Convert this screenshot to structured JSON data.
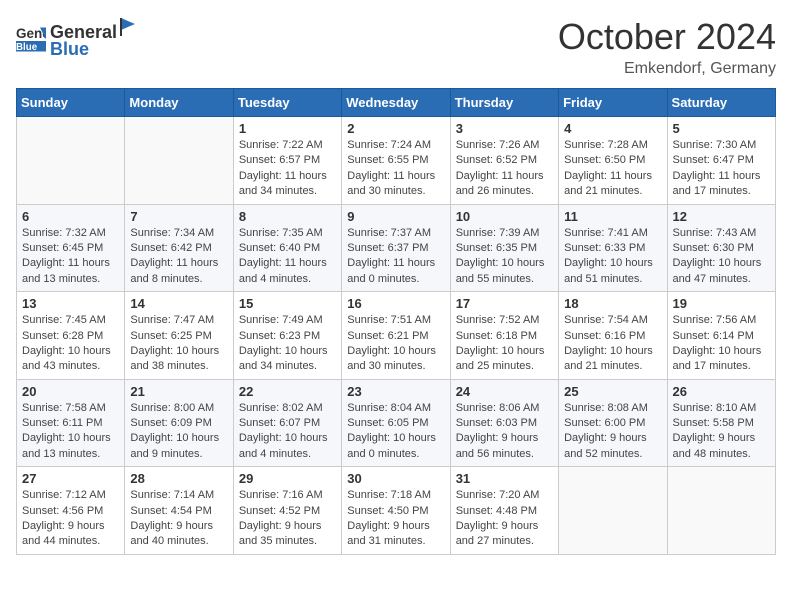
{
  "header": {
    "logo_general": "General",
    "logo_blue": "Blue",
    "month": "October 2024",
    "location": "Emkendorf, Germany"
  },
  "weekdays": [
    "Sunday",
    "Monday",
    "Tuesday",
    "Wednesday",
    "Thursday",
    "Friday",
    "Saturday"
  ],
  "weeks": [
    [
      {
        "day": "",
        "info": ""
      },
      {
        "day": "",
        "info": ""
      },
      {
        "day": "1",
        "info": "Sunrise: 7:22 AM\nSunset: 6:57 PM\nDaylight: 11 hours and 34 minutes."
      },
      {
        "day": "2",
        "info": "Sunrise: 7:24 AM\nSunset: 6:55 PM\nDaylight: 11 hours and 30 minutes."
      },
      {
        "day": "3",
        "info": "Sunrise: 7:26 AM\nSunset: 6:52 PM\nDaylight: 11 hours and 26 minutes."
      },
      {
        "day": "4",
        "info": "Sunrise: 7:28 AM\nSunset: 6:50 PM\nDaylight: 11 hours and 21 minutes."
      },
      {
        "day": "5",
        "info": "Sunrise: 7:30 AM\nSunset: 6:47 PM\nDaylight: 11 hours and 17 minutes."
      }
    ],
    [
      {
        "day": "6",
        "info": "Sunrise: 7:32 AM\nSunset: 6:45 PM\nDaylight: 11 hours and 13 minutes."
      },
      {
        "day": "7",
        "info": "Sunrise: 7:34 AM\nSunset: 6:42 PM\nDaylight: 11 hours and 8 minutes."
      },
      {
        "day": "8",
        "info": "Sunrise: 7:35 AM\nSunset: 6:40 PM\nDaylight: 11 hours and 4 minutes."
      },
      {
        "day": "9",
        "info": "Sunrise: 7:37 AM\nSunset: 6:37 PM\nDaylight: 11 hours and 0 minutes."
      },
      {
        "day": "10",
        "info": "Sunrise: 7:39 AM\nSunset: 6:35 PM\nDaylight: 10 hours and 55 minutes."
      },
      {
        "day": "11",
        "info": "Sunrise: 7:41 AM\nSunset: 6:33 PM\nDaylight: 10 hours and 51 minutes."
      },
      {
        "day": "12",
        "info": "Sunrise: 7:43 AM\nSunset: 6:30 PM\nDaylight: 10 hours and 47 minutes."
      }
    ],
    [
      {
        "day": "13",
        "info": "Sunrise: 7:45 AM\nSunset: 6:28 PM\nDaylight: 10 hours and 43 minutes."
      },
      {
        "day": "14",
        "info": "Sunrise: 7:47 AM\nSunset: 6:25 PM\nDaylight: 10 hours and 38 minutes."
      },
      {
        "day": "15",
        "info": "Sunrise: 7:49 AM\nSunset: 6:23 PM\nDaylight: 10 hours and 34 minutes."
      },
      {
        "day": "16",
        "info": "Sunrise: 7:51 AM\nSunset: 6:21 PM\nDaylight: 10 hours and 30 minutes."
      },
      {
        "day": "17",
        "info": "Sunrise: 7:52 AM\nSunset: 6:18 PM\nDaylight: 10 hours and 25 minutes."
      },
      {
        "day": "18",
        "info": "Sunrise: 7:54 AM\nSunset: 6:16 PM\nDaylight: 10 hours and 21 minutes."
      },
      {
        "day": "19",
        "info": "Sunrise: 7:56 AM\nSunset: 6:14 PM\nDaylight: 10 hours and 17 minutes."
      }
    ],
    [
      {
        "day": "20",
        "info": "Sunrise: 7:58 AM\nSunset: 6:11 PM\nDaylight: 10 hours and 13 minutes."
      },
      {
        "day": "21",
        "info": "Sunrise: 8:00 AM\nSunset: 6:09 PM\nDaylight: 10 hours and 9 minutes."
      },
      {
        "day": "22",
        "info": "Sunrise: 8:02 AM\nSunset: 6:07 PM\nDaylight: 10 hours and 4 minutes."
      },
      {
        "day": "23",
        "info": "Sunrise: 8:04 AM\nSunset: 6:05 PM\nDaylight: 10 hours and 0 minutes."
      },
      {
        "day": "24",
        "info": "Sunrise: 8:06 AM\nSunset: 6:03 PM\nDaylight: 9 hours and 56 minutes."
      },
      {
        "day": "25",
        "info": "Sunrise: 8:08 AM\nSunset: 6:00 PM\nDaylight: 9 hours and 52 minutes."
      },
      {
        "day": "26",
        "info": "Sunrise: 8:10 AM\nSunset: 5:58 PM\nDaylight: 9 hours and 48 minutes."
      }
    ],
    [
      {
        "day": "27",
        "info": "Sunrise: 7:12 AM\nSunset: 4:56 PM\nDaylight: 9 hours and 44 minutes."
      },
      {
        "day": "28",
        "info": "Sunrise: 7:14 AM\nSunset: 4:54 PM\nDaylight: 9 hours and 40 minutes."
      },
      {
        "day": "29",
        "info": "Sunrise: 7:16 AM\nSunset: 4:52 PM\nDaylight: 9 hours and 35 minutes."
      },
      {
        "day": "30",
        "info": "Sunrise: 7:18 AM\nSunset: 4:50 PM\nDaylight: 9 hours and 31 minutes."
      },
      {
        "day": "31",
        "info": "Sunrise: 7:20 AM\nSunset: 4:48 PM\nDaylight: 9 hours and 27 minutes."
      },
      {
        "day": "",
        "info": ""
      },
      {
        "day": "",
        "info": ""
      }
    ]
  ]
}
